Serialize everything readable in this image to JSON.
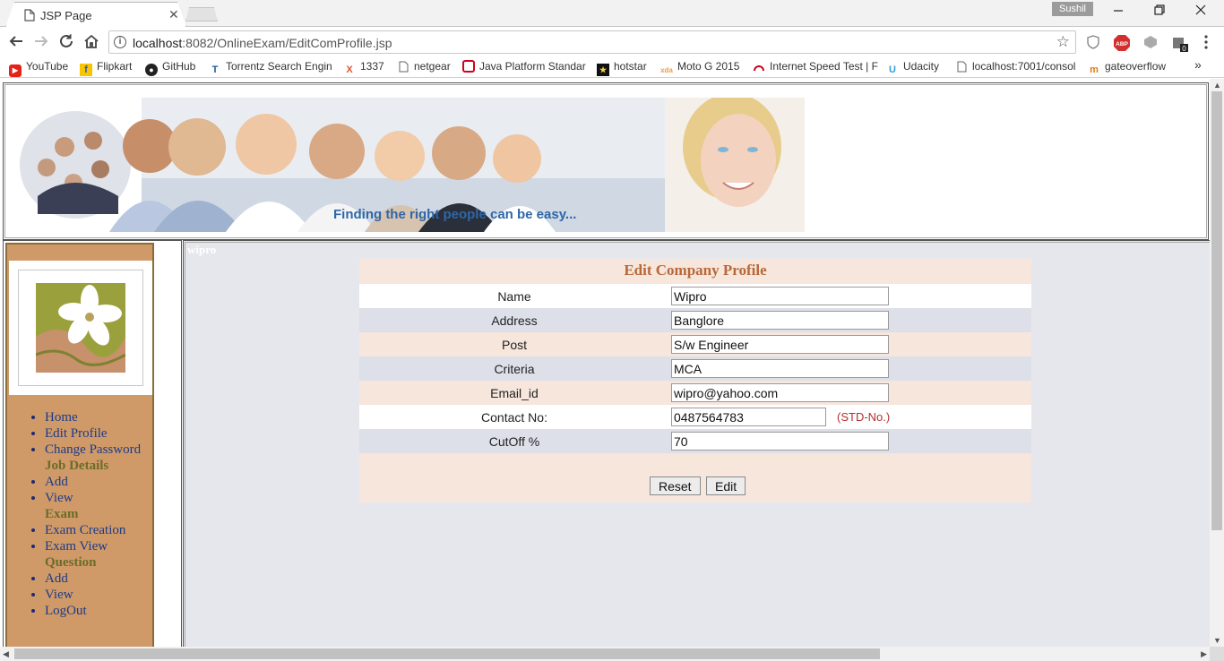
{
  "browser": {
    "tab_title": "JSP Page",
    "tab_close": "✕",
    "profile_name": "Sushil",
    "url_host": "localhost",
    "url_rest": ":8082/OnlineExam/EditComProfile.jsp",
    "abp_label": "ABP",
    "ext_badge": "0"
  },
  "bookmarks": [
    {
      "label": "YouTube",
      "icon": "youtube-icon",
      "color": "#e62117"
    },
    {
      "label": "Flipkart",
      "icon": "flipkart-icon",
      "color": "#f7c600"
    },
    {
      "label": "GitHub",
      "icon": "github-icon",
      "color": "#222222"
    },
    {
      "label": "Torrentz Search Engin",
      "icon": "torrentz-icon",
      "color": "#1a5aa5"
    },
    {
      "label": "1337",
      "icon": "x-icon",
      "color": "#e2542b"
    },
    {
      "label": "netgear",
      "icon": "page-icon",
      "color": "#777777"
    },
    {
      "label": "Java Platform Standar",
      "icon": "oracle-icon",
      "color": "#d0021b"
    },
    {
      "label": "hotstar",
      "icon": "hotstar-icon",
      "color": "#111111"
    },
    {
      "label": "Moto G 2015",
      "icon": "xda-icon",
      "color": "#f29a4a"
    },
    {
      "label": "Internet Speed Test | F",
      "icon": "speedtest-icon",
      "color": "#d0021b"
    },
    {
      "label": "Udacity",
      "icon": "udacity-icon",
      "color": "#2d9fd8"
    },
    {
      "label": "localhost:7001/consol",
      "icon": "page-icon",
      "color": "#777777"
    },
    {
      "label": "gateoverflow",
      "icon": "gateoverflow-icon",
      "color": "#e07b1a"
    }
  ],
  "bookmarks_overflow": "»",
  "banner": {
    "tagline": "Finding the right people can be easy..."
  },
  "sidebar": {
    "items": [
      {
        "label": "Home",
        "type": "link"
      },
      {
        "label": "Edit Profile",
        "type": "link"
      },
      {
        "label": "Change Password",
        "type": "link"
      },
      {
        "label": "Job Details",
        "type": "heading"
      },
      {
        "label": "Add",
        "type": "link"
      },
      {
        "label": "View",
        "type": "link"
      },
      {
        "label": "Exam",
        "type": "heading"
      },
      {
        "label": "Exam Creation",
        "type": "link"
      },
      {
        "label": "Exam View",
        "type": "link"
      },
      {
        "label": "Question",
        "type": "heading"
      },
      {
        "label": "Add",
        "type": "link"
      },
      {
        "label": "View",
        "type": "link"
      },
      {
        "label": "LogOut",
        "type": "link"
      }
    ]
  },
  "content": {
    "user": "wipro",
    "form_title": "Edit Company Profile",
    "fields": [
      {
        "label": "Name",
        "value": "Wipro"
      },
      {
        "label": "Address",
        "value": "Banglore"
      },
      {
        "label": "Post",
        "value": "S/w Engineer"
      },
      {
        "label": "Criteria",
        "value": "MCA"
      },
      {
        "label": "Email_id",
        "value": "wipro@yahoo.com"
      },
      {
        "label": "Contact No:",
        "value": "0487564783",
        "hint": "(STD-No.)"
      },
      {
        "label": "CutOff %",
        "value": "70"
      }
    ],
    "reset_label": "Reset",
    "edit_label": "Edit"
  },
  "colors": {
    "sidebar_bg": "#d09a68",
    "menu_link": "#1c3a8a",
    "menu_heading": "#6b6b2a",
    "form_title": "#b8683a",
    "content_bg": "#e6e7ec"
  }
}
